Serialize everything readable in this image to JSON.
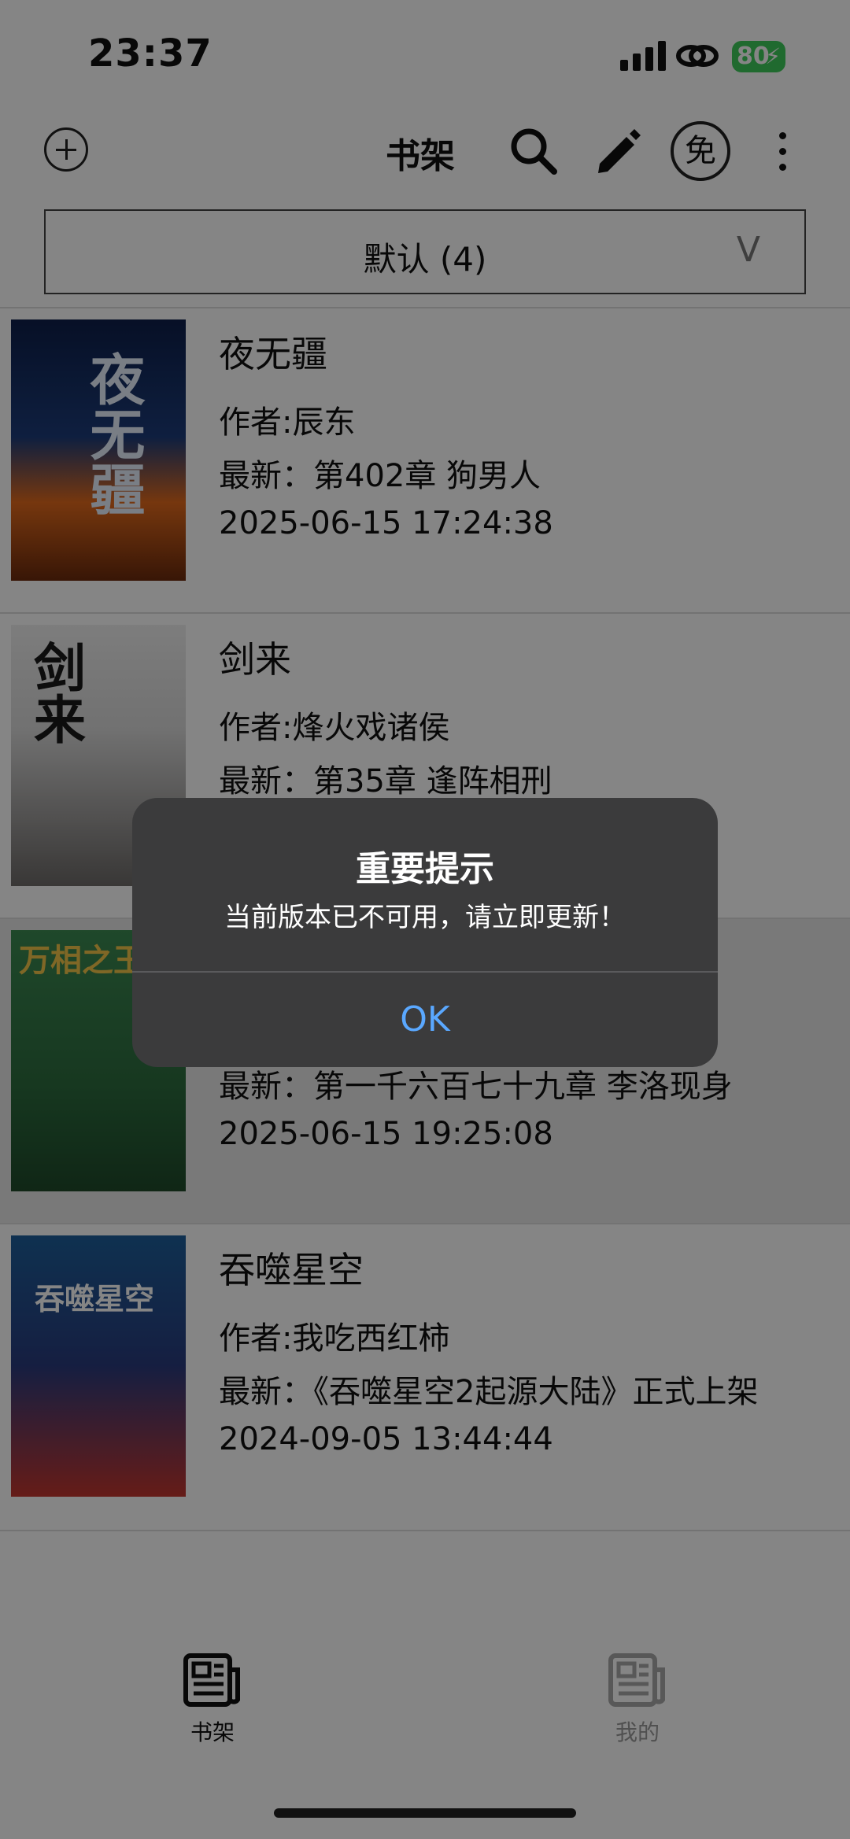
{
  "status_bar": {
    "time": "23:37",
    "battery": "80"
  },
  "topbar": {
    "title": "书架",
    "free_label": "免"
  },
  "group_selector": {
    "label": "默认 (4)",
    "chevron": "V"
  },
  "books": [
    {
      "title": "夜无疆",
      "author": "作者:辰东",
      "latest": "最新：第402章 狗男人",
      "updated": "2025-06-15 17:24:38",
      "cover_text": "夜无疆"
    },
    {
      "title": "剑来",
      "author": "作者:烽火戏诸侯",
      "latest": "最新：第35章 逢阵相刑",
      "updated": "",
      "cover_text": "剑来"
    },
    {
      "title": "",
      "author": "",
      "latest": "最新：第一千六百七十九章 李洛现身",
      "updated": "2025-06-15 19:25:08",
      "cover_text": "万相之王"
    },
    {
      "title": "吞噬星空",
      "author": "作者:我吃西红柿",
      "latest": "最新：《吞噬星空2起源大陆》正式上架",
      "updated": "2024-09-05 13:44:44",
      "cover_text": "吞噬星空"
    }
  ],
  "alert": {
    "title": "重要提示",
    "message": "当前版本已不可用，请立即更新！",
    "ok_label": "OK"
  },
  "tabs": [
    {
      "label": "书架"
    },
    {
      "label": "我的"
    }
  ],
  "colors": {
    "alert_bg": "#3b3b3c",
    "ok_blue": "#5aa8ff",
    "battery_green": "#3ecb5a"
  }
}
